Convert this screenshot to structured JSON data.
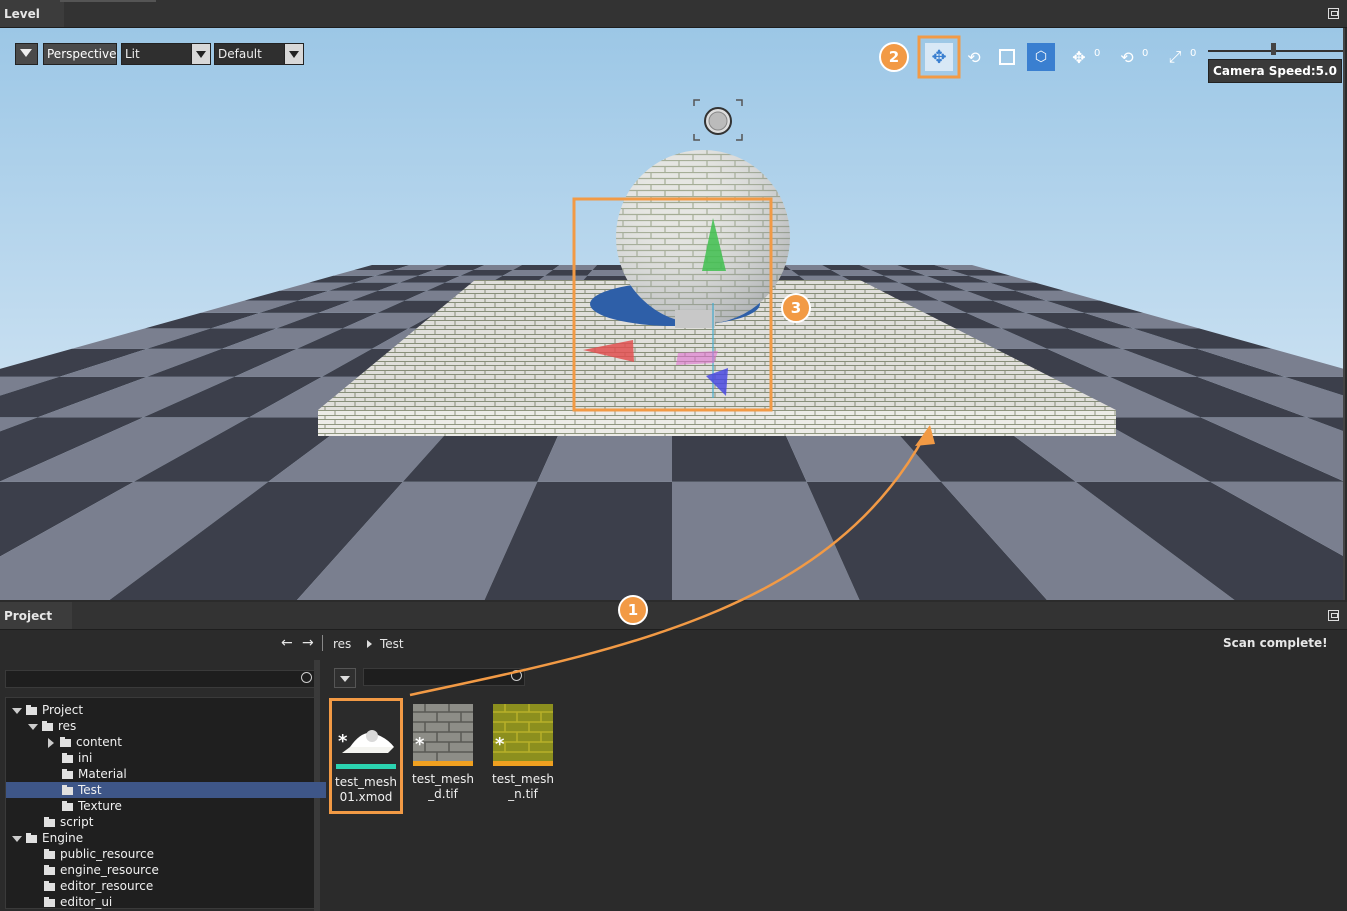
{
  "level_panel": {
    "title": "Level"
  },
  "viewport": {
    "view_mode": "Perspective",
    "lighting": "Lit",
    "preset": "Default",
    "camera_speed": "Camera Speed:5.0",
    "tools": [
      {
        "icon": "move-icon",
        "active": true
      },
      {
        "icon": "rotate-icon"
      },
      {
        "icon": "scale-icon"
      },
      {
        "icon": "local-space-icon"
      },
      {
        "icon": "move-snap-icon",
        "value": "0"
      },
      {
        "icon": "rotate-snap-icon",
        "value": "0"
      },
      {
        "icon": "scale-snap-icon",
        "value": "0"
      }
    ],
    "colors": {
      "sky_top": "#9cc7e6",
      "sky_bottom": "#e2eef8",
      "highlight": "#f29a45",
      "floor_light": "#7a7f8f",
      "floor_dark": "#3c3f4b"
    }
  },
  "callouts": [
    "1",
    "2",
    "3"
  ],
  "project_panel": {
    "title": "Project",
    "path": [
      "res",
      "Test"
    ],
    "status": "Scan complete!",
    "tree": [
      {
        "label": "Project",
        "depth": 0,
        "state": "open"
      },
      {
        "label": "res",
        "depth": 1,
        "state": "open"
      },
      {
        "label": "content",
        "depth": 2,
        "state": "closed"
      },
      {
        "label": "ini",
        "depth": 2,
        "state": "leaf"
      },
      {
        "label": "Material",
        "depth": 2,
        "state": "leaf"
      },
      {
        "label": "Test",
        "depth": 2,
        "state": "leaf",
        "selected": true
      },
      {
        "label": "Texture",
        "depth": 2,
        "state": "leaf"
      },
      {
        "label": "script",
        "depth": 1,
        "state": "leaf"
      },
      {
        "label": "Engine",
        "depth": 0,
        "state": "open"
      },
      {
        "label": "public_resource",
        "depth": 1,
        "state": "leaf"
      },
      {
        "label": "engine_resource",
        "depth": 1,
        "state": "leaf"
      },
      {
        "label": "editor_resource",
        "depth": 1,
        "state": "leaf"
      },
      {
        "label": "editor_ui",
        "depth": 1,
        "state": "leaf"
      }
    ],
    "assets": [
      {
        "name": "test_mesh01.xmod",
        "line1": "test_mesh",
        "line2": "01.xmod",
        "bar_color": "#2bd3b0",
        "highlighted": true
      },
      {
        "name": "test_mesh_d.tif",
        "line1": "test_mesh",
        "line2": "_d.tif",
        "bar_color": "#f0a020"
      },
      {
        "name": "test_mesh_n.tif",
        "line1": "test_mesh",
        "line2": "_n.tif",
        "bar_color": "#f0a020"
      }
    ]
  }
}
